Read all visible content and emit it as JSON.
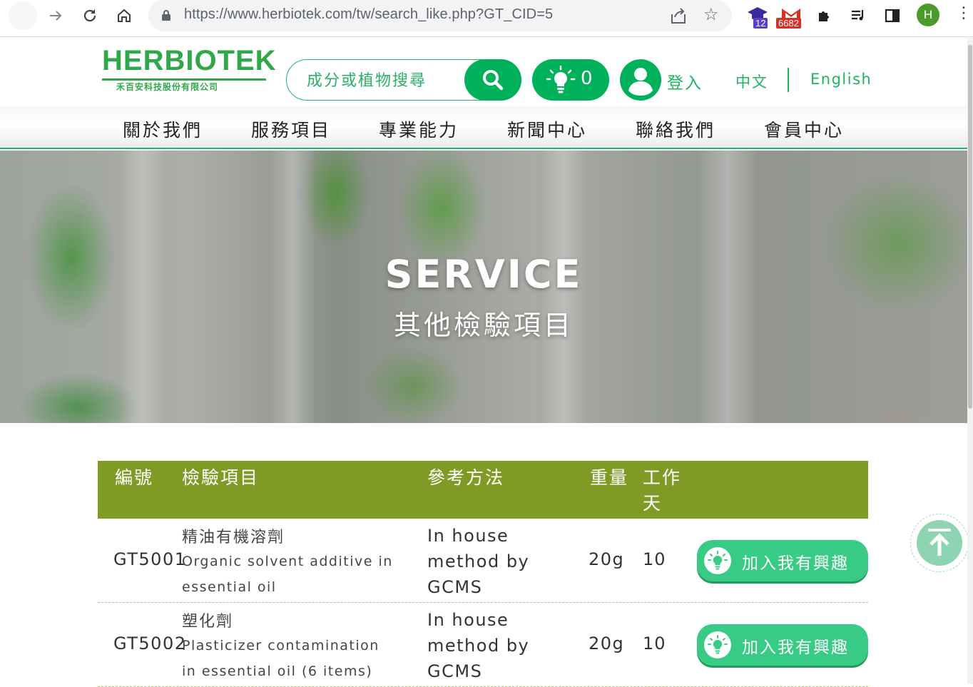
{
  "browser": {
    "url": "https://www.herbiotek.com/tw/search_like.php?GT_CID=5",
    "extensions": [
      {
        "name": "graduation-cap-extension",
        "badge": "12",
        "badge_color": "#5b3fc8"
      },
      {
        "name": "gmail-extension",
        "badge": "6682",
        "badge_color": "#d93025"
      }
    ],
    "profile_initial": "H",
    "icons": [
      "back-arrow-icon",
      "forward-arrow-icon",
      "reload-icon",
      "home-icon",
      "lock-icon",
      "share-icon",
      "star-icon",
      "puzzle-icon",
      "media-list-icon",
      "side-panel-icon",
      "more-vert-icon"
    ]
  },
  "header": {
    "logo_text": "HERBIOTEK",
    "logo_subtitle": "禾百安科技股份有限公司",
    "search_placeholder": "成分或植物搜尋",
    "interest_count": "0",
    "login_label": "登入",
    "lang_zh": "中文",
    "lang_en": "English",
    "accent_color": "#00b15c"
  },
  "nav": {
    "items": [
      {
        "label": "關於我們"
      },
      {
        "label": "服務項目"
      },
      {
        "label": "專業能力"
      },
      {
        "label": "新聞中心"
      },
      {
        "label": "聯絡我們"
      },
      {
        "label": "會員中心"
      }
    ]
  },
  "banner": {
    "title": "SERVICE",
    "subtitle": "其他檢驗項目"
  },
  "table": {
    "header_color": "#7f9b25",
    "columns": {
      "code": "編號",
      "item": "檢驗項目",
      "method": "參考方法",
      "weight": "重量",
      "days": "工作天"
    },
    "rows": [
      {
        "code": "GT5001",
        "name_zh": "精油有機溶劑",
        "name_en": "Organic solvent additive in essential oil",
        "method": "In house method by GCMS",
        "weight": "20g",
        "days": "10",
        "button": "加入我有興趣"
      },
      {
        "code": "GT5002",
        "name_zh": "塑化劑",
        "name_en": "Plasticizer contamination in essential oil (6 items)",
        "method": "In house method by GCMS",
        "weight": "20g",
        "days": "10",
        "button": "加入我有興趣"
      }
    ]
  }
}
